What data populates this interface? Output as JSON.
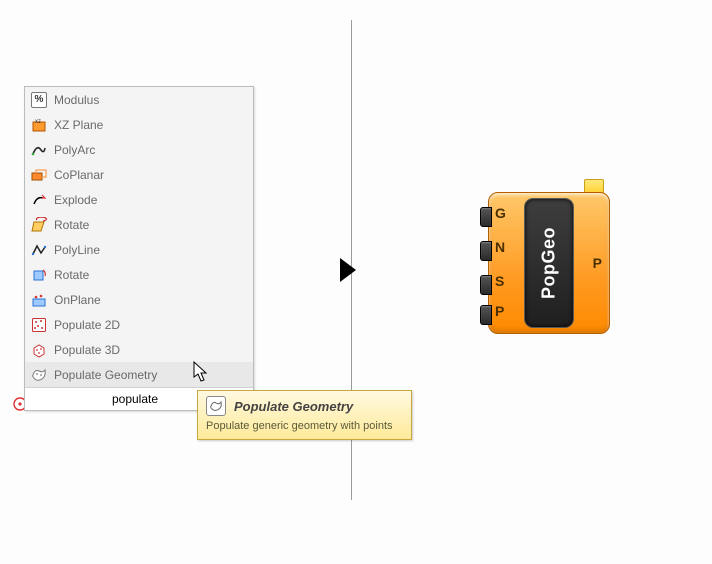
{
  "search": {
    "value": "populate",
    "items": [
      {
        "label": "Modulus",
        "icon": "percent",
        "name": "modulus"
      },
      {
        "label": "XZ Plane",
        "icon": "xzplane",
        "name": "xz-plane"
      },
      {
        "label": "PolyArc",
        "icon": "polyarc",
        "name": "polyarc"
      },
      {
        "label": "CoPlanar",
        "icon": "coplanar",
        "name": "coplanar"
      },
      {
        "label": "Explode",
        "icon": "explode",
        "name": "explode"
      },
      {
        "label": "Rotate",
        "icon": "rotate-y",
        "name": "rotate-1"
      },
      {
        "label": "PolyLine",
        "icon": "polyline",
        "name": "polyline"
      },
      {
        "label": "Rotate",
        "icon": "rotate-sq",
        "name": "rotate-2"
      },
      {
        "label": "OnPlane",
        "icon": "onplane",
        "name": "onplane"
      },
      {
        "label": "Populate 2D",
        "icon": "pop2d",
        "name": "populate-2d"
      },
      {
        "label": "Populate 3D",
        "icon": "pop3d",
        "name": "populate-3d"
      },
      {
        "label": "Populate Geometry",
        "icon": "popgeo",
        "name": "populate-geometry",
        "selected": true
      }
    ]
  },
  "tooltip": {
    "title": "Populate Geometry",
    "body": "Populate generic geometry with points"
  },
  "component": {
    "name": "PopGeo",
    "inputs": [
      "G",
      "N",
      "S",
      "P"
    ],
    "outputs": [
      "P"
    ]
  }
}
